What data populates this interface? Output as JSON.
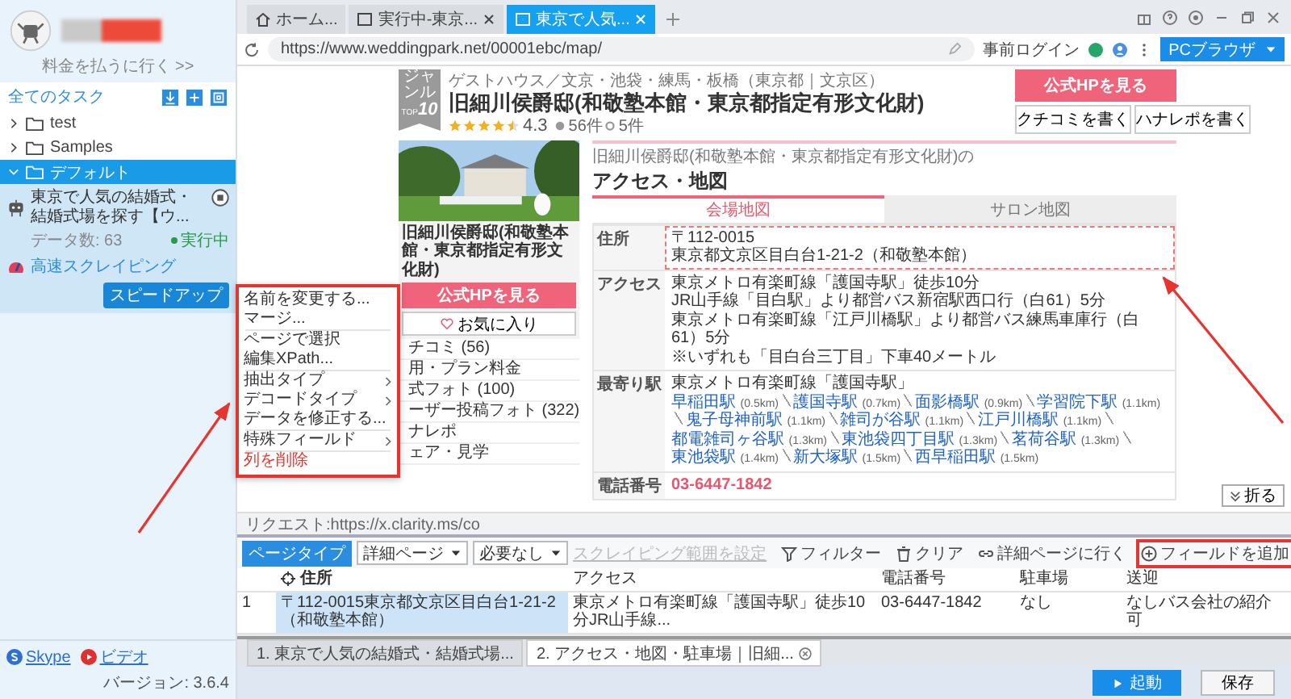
{
  "sidebar": {
    "account": {
      "link": "料金を払うに行く >>"
    },
    "tree_title": "全てのタスク",
    "folders": [
      {
        "name": "test",
        "expanded": false,
        "selected": false
      },
      {
        "name": "Samples",
        "expanded": false,
        "selected": false
      },
      {
        "name": "デフォルト",
        "expanded": true,
        "selected": true,
        "children": [
          {
            "title": "東京で人気の結婚式・結婚式場を探す【ウ...",
            "data_count": "データ数: 63",
            "status": "実行中",
            "mode": "高速スクレイピング",
            "action": "スピードアップ"
          }
        ]
      }
    ],
    "footer": {
      "links": [
        {
          "label": "Skype",
          "kind": "skype"
        },
        {
          "label": "ビデオ",
          "kind": "video"
        }
      ],
      "version": "バージョン: 3.6.4"
    }
  },
  "browser": {
    "tabs": [
      {
        "label": "ホーム...",
        "selected": false,
        "closable": false
      },
      {
        "label": "実行中-東京...",
        "selected": false,
        "closable": true
      },
      {
        "label": "東京で人気...",
        "selected": true,
        "closable": true
      }
    ],
    "url": "https://www.weddingpark.net/00001ebc/map/",
    "login": "事前ログイン",
    "mode": "PCブラウザ",
    "request": "リクエスト:https://x.clarity.ms/co",
    "collapse": "折る"
  },
  "page": {
    "badge_label": "ジャンル",
    "badge_prefix": "TOP",
    "badge_rank": "10",
    "category": "ゲストハウス／文京・池袋・練馬・板橋（東京都｜文京区）",
    "title": "旧細川侯爵邸(和敬塾本館・東京都指定有形文化財)",
    "rating": {
      "stars": 4.5,
      "score": "4.3",
      "reviews": "56件",
      "reports": "5件"
    },
    "cta": "公式HPを見る",
    "write_buttons": [
      "クチコミを書く",
      "ハナレポを書く"
    ],
    "card": {
      "title": "旧細川侯爵邸(和敬塾本館・東京都指定有形文化財)",
      "cta": "公式HPを見る",
      "favorite": "お気に入り",
      "nav": [
        "チコミ (56)",
        "用・プラン料金",
        "式フォト (100)",
        "ーザー投稿フォト (322)",
        "ナレポ",
        "ェア・見学"
      ]
    },
    "breadcrumb": "旧細川侯爵邸(和敬塾本館・東京都指定有形文化財)の",
    "heading": "アクセス・地図",
    "map_tabs": [
      {
        "label": "会場地図",
        "selected": true
      },
      {
        "label": "サロン地図",
        "selected": false
      }
    ],
    "info": [
      {
        "label": "住所",
        "kind": "text",
        "highlighted": true,
        "lines": [
          "〒112-0015",
          "東京都文京区目白台1-21-2（和敬塾本館）"
        ]
      },
      {
        "label": "アクセス",
        "kind": "text",
        "highlighted": false,
        "lines": [
          "東京メトロ有楽町線「護国寺駅」徒歩10分",
          "JR山手線「目白駅」より都営バス新宿駅西口行（白61）5分",
          "東京メトロ有楽町線「江戸川橋駅」より都営バス練馬車庫行（白61）5分",
          "※いずれも「目白台三丁目」下車40メートル"
        ]
      },
      {
        "label": "最寄り駅",
        "kind": "stations",
        "highlighted": false,
        "intro": "東京メトロ有楽町線「護国寺駅」",
        "stations": [
          {
            "name": "早稲田駅",
            "distance": "(0.5km)"
          },
          {
            "name": "護国寺駅",
            "distance": "(0.7km)"
          },
          {
            "name": "面影橋駅",
            "distance": "(0.9km)"
          },
          {
            "name": "学習院下駅",
            "distance": "(1.1km)"
          },
          {
            "name": "鬼子母神前駅",
            "distance": "(1.1km)"
          },
          {
            "name": "雑司が谷駅",
            "distance": "(1.1km)"
          },
          {
            "name": "江戸川橋駅",
            "distance": "(1.1km)"
          },
          {
            "name": "都電雑司ヶ谷駅",
            "distance": "(1.3km)"
          },
          {
            "name": "東池袋四丁目駅",
            "distance": "(1.3km)"
          },
          {
            "name": "茗荷谷駅",
            "distance": "(1.3km)"
          },
          {
            "name": "東池袋駅",
            "distance": "(1.4km)"
          },
          {
            "name": "新大塚駅",
            "distance": "(1.5km)"
          },
          {
            "name": "西早稲田駅",
            "distance": "(1.5km)"
          }
        ]
      },
      {
        "label": "電話番号",
        "kind": "phone",
        "highlighted": false,
        "value": "03-6447-1842"
      }
    ]
  },
  "context_menu": {
    "highlighted": true,
    "items": [
      {
        "label": "名前を変更する...",
        "submenu": false,
        "danger": false,
        "separator_before": false
      },
      {
        "label": "マージ...",
        "submenu": false,
        "danger": false,
        "separator_before": false
      },
      {
        "label": "ページで選択",
        "submenu": false,
        "danger": false,
        "separator_before": true
      },
      {
        "label": "編集XPath...",
        "submenu": false,
        "danger": false,
        "separator_before": false
      },
      {
        "label": "抽出タイプ",
        "submenu": true,
        "danger": false,
        "separator_before": true
      },
      {
        "label": "デコードタイプ",
        "submenu": true,
        "danger": false,
        "separator_before": false
      },
      {
        "label": "データを修正する...",
        "submenu": false,
        "danger": false,
        "separator_before": false
      },
      {
        "label": "特殊フィールド",
        "submenu": true,
        "danger": false,
        "separator_before": true
      },
      {
        "label": "列を削除",
        "submenu": false,
        "danger": true,
        "separator_before": true
      }
    ]
  },
  "panel": {
    "page_type": "ページタイプ",
    "detail_select": "詳細ページ",
    "paging_select": "必要なし",
    "range_link": {
      "label": "スクレイピング範囲を設定",
      "disabled": true
    },
    "tools": [
      {
        "label": "フィルター",
        "kind": "filter",
        "highlighted": false
      },
      {
        "label": "クリア",
        "kind": "clear",
        "highlighted": false
      },
      {
        "label": "詳細ページに行く",
        "kind": "link",
        "highlighted": false
      },
      {
        "label": "フィールドを追加",
        "kind": "add",
        "highlighted": true
      }
    ],
    "columns": [
      {
        "label": "住所",
        "selected": true
      },
      {
        "label": "アクセス",
        "selected": false
      },
      {
        "label": "電話番号",
        "selected": false
      },
      {
        "label": "駐車場",
        "selected": false
      },
      {
        "label": "送迎",
        "selected": false
      }
    ],
    "rows": [
      {
        "index": "1",
        "cells": [
          "〒112-0015東京都文京区目白台1-21-2（和敬塾本館）",
          "東京メトロ有楽町線「護国寺駅」徒歩10分JR山手線...",
          "03-6447-1842",
          "なし",
          "なしバス会社の紹介可"
        ]
      }
    ]
  },
  "run_tabs": [
    {
      "label": "1. 東京で人気の結婚式・結婚式場...",
      "selected": false
    },
    {
      "label": "2. アクセス・地図・駐車場｜旧細...",
      "selected": true
    }
  ],
  "buttons": {
    "start": "起動",
    "save": "保存"
  }
}
